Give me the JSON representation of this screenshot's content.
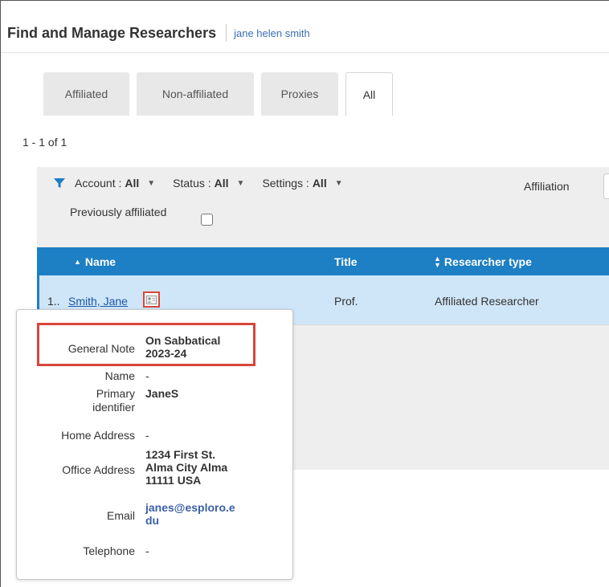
{
  "header": {
    "title": "Find and Manage Researchers",
    "user": "jane helen smith"
  },
  "tabs": [
    {
      "label": "Affiliated",
      "active": false
    },
    {
      "label": "Non-affiliated",
      "active": false
    },
    {
      "label": "Proxies",
      "active": false
    },
    {
      "label": "All",
      "active": true
    }
  ],
  "results": {
    "count_text": "1 - 1 of 1"
  },
  "filters": {
    "account_label": "Account :",
    "account_value": "All",
    "status_label": "Status :",
    "status_value": "All",
    "settings_label": "Settings :",
    "settings_value": "All",
    "affiliation_label": "Affiliation",
    "previously_affiliated_label": "Previously affiliated"
  },
  "table": {
    "columns": {
      "name": "Name",
      "title": "Title",
      "researcher_type": "Researcher type"
    },
    "rows": [
      {
        "index": "1..",
        "name": "Smith, Jane",
        "title": "Prof.",
        "researcher_type": "Affiliated Researcher"
      }
    ]
  },
  "popup": {
    "general_note_label": "General Note",
    "general_note_value_line1": "On Sabbatical",
    "general_note_value_line2": "2023-24",
    "name_label": "Name",
    "name_value": "-",
    "primary_identifier_label_line1": "Primary",
    "primary_identifier_label_line2": "identifier",
    "primary_identifier_value": "JaneS",
    "home_address_label": "Home Address",
    "home_address_value": "-",
    "office_address_label": "Office Address",
    "office_address_line1": "1234 First St.",
    "office_address_line2": "Alma City Alma",
    "office_address_line3": "11111 USA",
    "email_label": "Email",
    "email_line1": "janes@esploro.e",
    "email_line2": "du",
    "telephone_label": "Telephone",
    "telephone_value": "-"
  },
  "colors": {
    "accent": "#1d7fc4",
    "highlight": "#d9453a",
    "row_selected": "#cfe6f8",
    "link": "#1a56a6"
  }
}
